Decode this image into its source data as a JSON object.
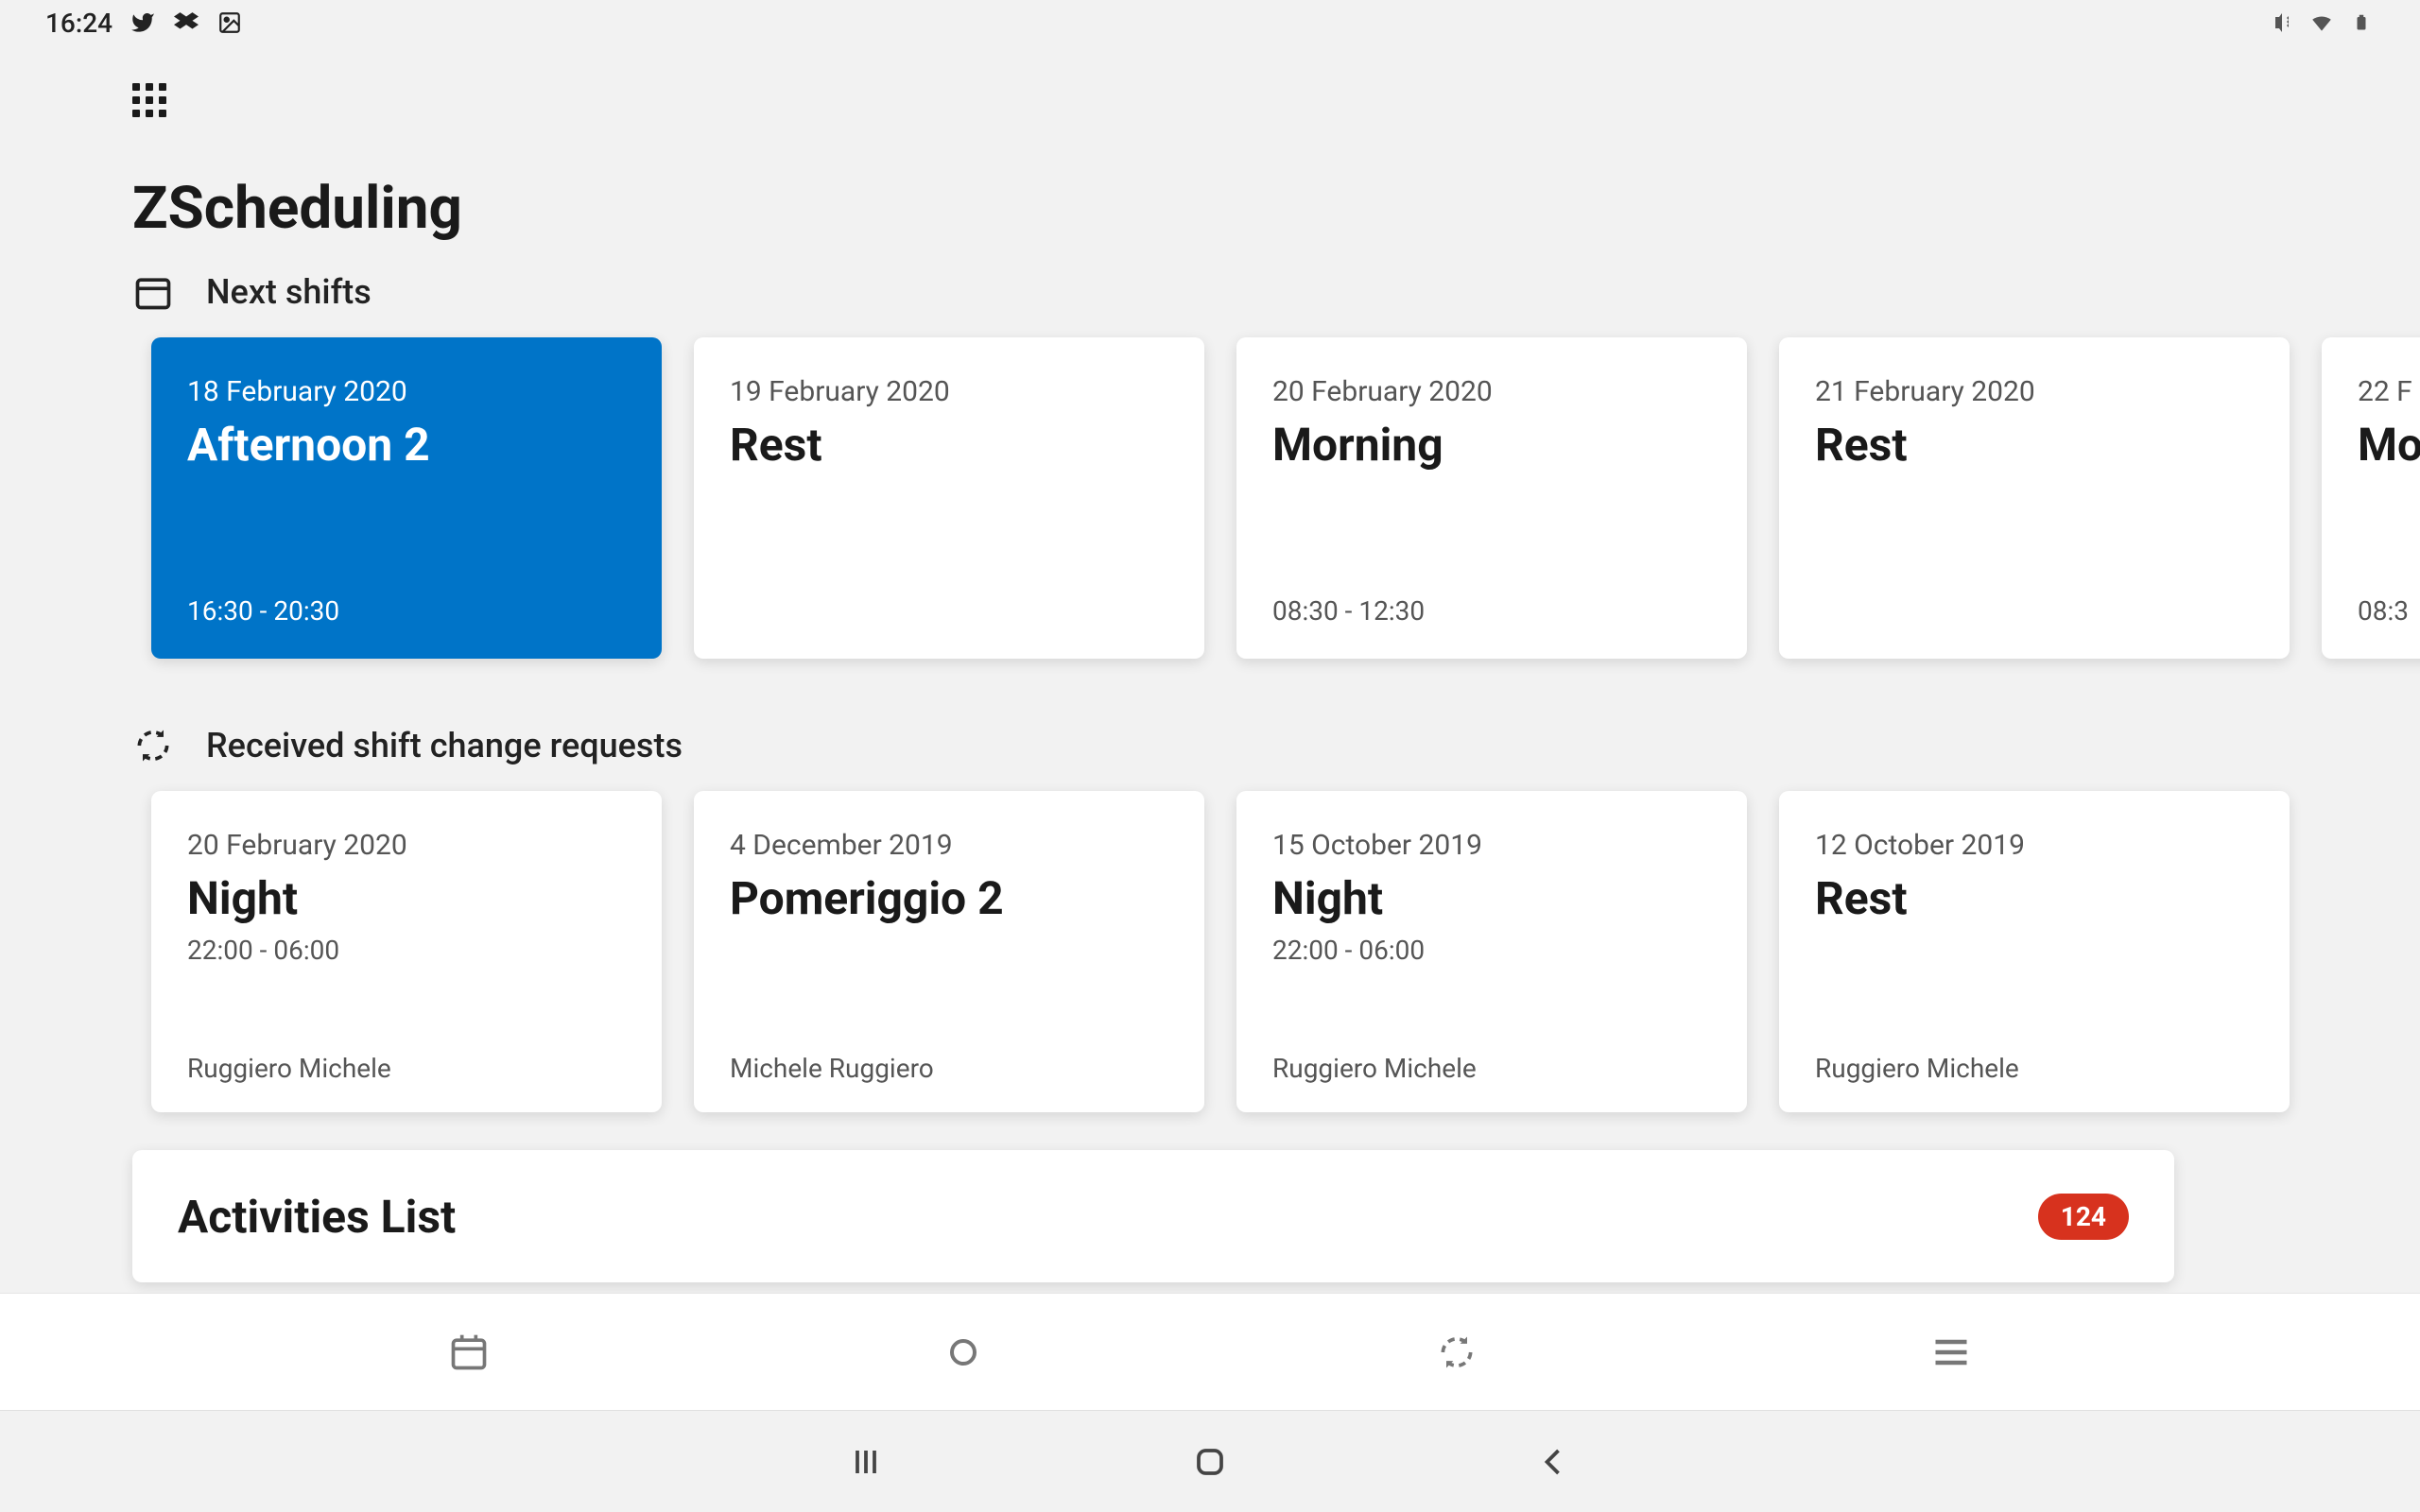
{
  "status_bar": {
    "time": "16:24"
  },
  "app": {
    "title": "ZScheduling",
    "sections": {
      "next_shifts": {
        "title": "Next shifts",
        "cards": [
          {
            "date": "18 February 2020",
            "shift": "Afternoon 2",
            "time": "16:30 - 20:30",
            "selected": true
          },
          {
            "date": "19 February 2020",
            "shift": "Rest",
            "time": ""
          },
          {
            "date": "20 February 2020",
            "shift": "Morning",
            "time": "08:30 - 12:30"
          },
          {
            "date": "21 February 2020",
            "shift": "Rest",
            "time": ""
          },
          {
            "date": "22 F",
            "shift": "Mo",
            "time": "08:3"
          }
        ]
      },
      "requests": {
        "title": "Received shift change requests",
        "cards": [
          {
            "date": "20 February 2020",
            "shift": "Night",
            "time": "22:00 - 06:00",
            "requester": "Ruggiero Michele"
          },
          {
            "date": "4 December 2019",
            "shift": "Pomeriggio 2",
            "time": "",
            "requester": "Michele Ruggiero"
          },
          {
            "date": "15 October 2019",
            "shift": "Night",
            "time": "22:00 - 06:00",
            "requester": "Ruggiero Michele"
          },
          {
            "date": "12 October 2019",
            "shift": "Rest",
            "time": "",
            "requester": "Ruggiero Michele"
          }
        ]
      },
      "activities": {
        "title": "Activities List",
        "badge": "124"
      }
    }
  }
}
